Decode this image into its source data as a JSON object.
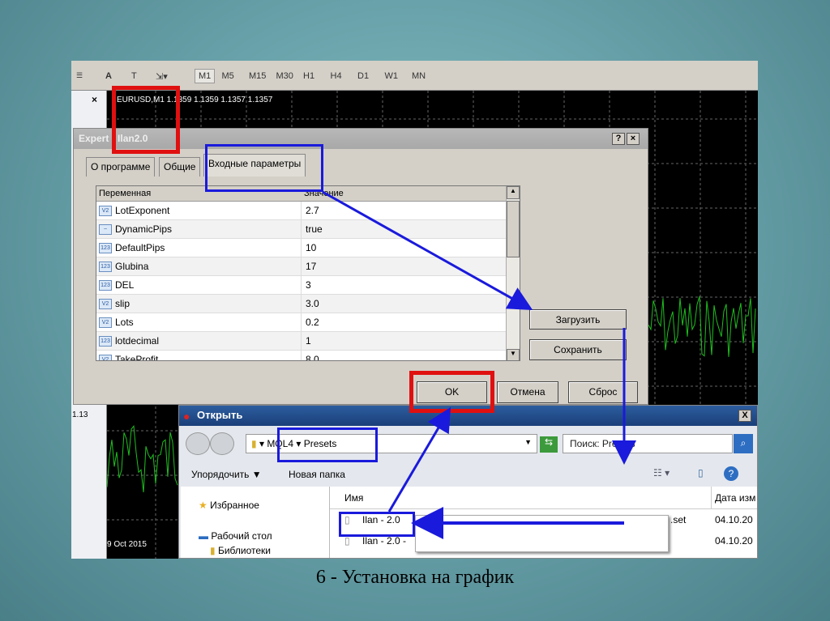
{
  "toolbar": {
    "timeframes": [
      "M1",
      "M5",
      "M15",
      "M30",
      "H1",
      "H4",
      "D1",
      "W1",
      "MN"
    ],
    "selected": "M1"
  },
  "chart": {
    "header": "EURUSD,M1  1.1359 1.1359 1.1357 1.1357",
    "price_label": "1.13",
    "date_label": "9 Oct 2015"
  },
  "left_panel": {
    "close": "×"
  },
  "expert_dialog": {
    "title_prefix": "Expert -",
    "title_name": "Ilan2.0",
    "help": "?",
    "close": "×",
    "tabs": [
      "О программе",
      "Общие",
      "Входные параметры"
    ],
    "columns": [
      "Переменная",
      "Значение"
    ],
    "rows": [
      {
        "icon": "V2",
        "name": "LotExponent",
        "value": "2.7"
      },
      {
        "icon": "~",
        "name": "DynamicPips",
        "value": "true"
      },
      {
        "icon": "123",
        "name": "DefaultPips",
        "value": "10"
      },
      {
        "icon": "123",
        "name": "Glubina",
        "value": "17"
      },
      {
        "icon": "123",
        "name": "DEL",
        "value": "3"
      },
      {
        "icon": "V2",
        "name": "slip",
        "value": "3.0"
      },
      {
        "icon": "V2",
        "name": "Lots",
        "value": "0.2"
      },
      {
        "icon": "123",
        "name": "lotdecimal",
        "value": "1"
      },
      {
        "icon": "V2",
        "name": "TakeProfit",
        "value": "8.0"
      }
    ],
    "load": "Загрузить",
    "save": "Сохранить",
    "ok": "OK",
    "cancel": "Отмена",
    "reset": "Сброс"
  },
  "open_dialog": {
    "title": "Открыть",
    "close": "X",
    "path": [
      "MQL4",
      "Presets"
    ],
    "search_placeholder": "Поиск: Presets",
    "organize": "Упорядочить ▼",
    "new_folder": "Новая папка",
    "nav": [
      "Избранное",
      "Рабочий стол",
      "Библиотеки"
    ],
    "columns": [
      "Имя",
      "Дата изм"
    ],
    "files": [
      {
        "name": "Ilan - 2.0",
        "ext": ".set",
        "date": "04.10.20"
      },
      {
        "name": "Ilan - 2.0 - ",
        "ext": "",
        "date": "04.10.20"
      }
    ]
  },
  "caption": "6 - Установка на график",
  "colors": {
    "highlight_red": "#e01010",
    "highlight_blue": "#1a1adc",
    "chart_line": "#1fbf1f"
  }
}
